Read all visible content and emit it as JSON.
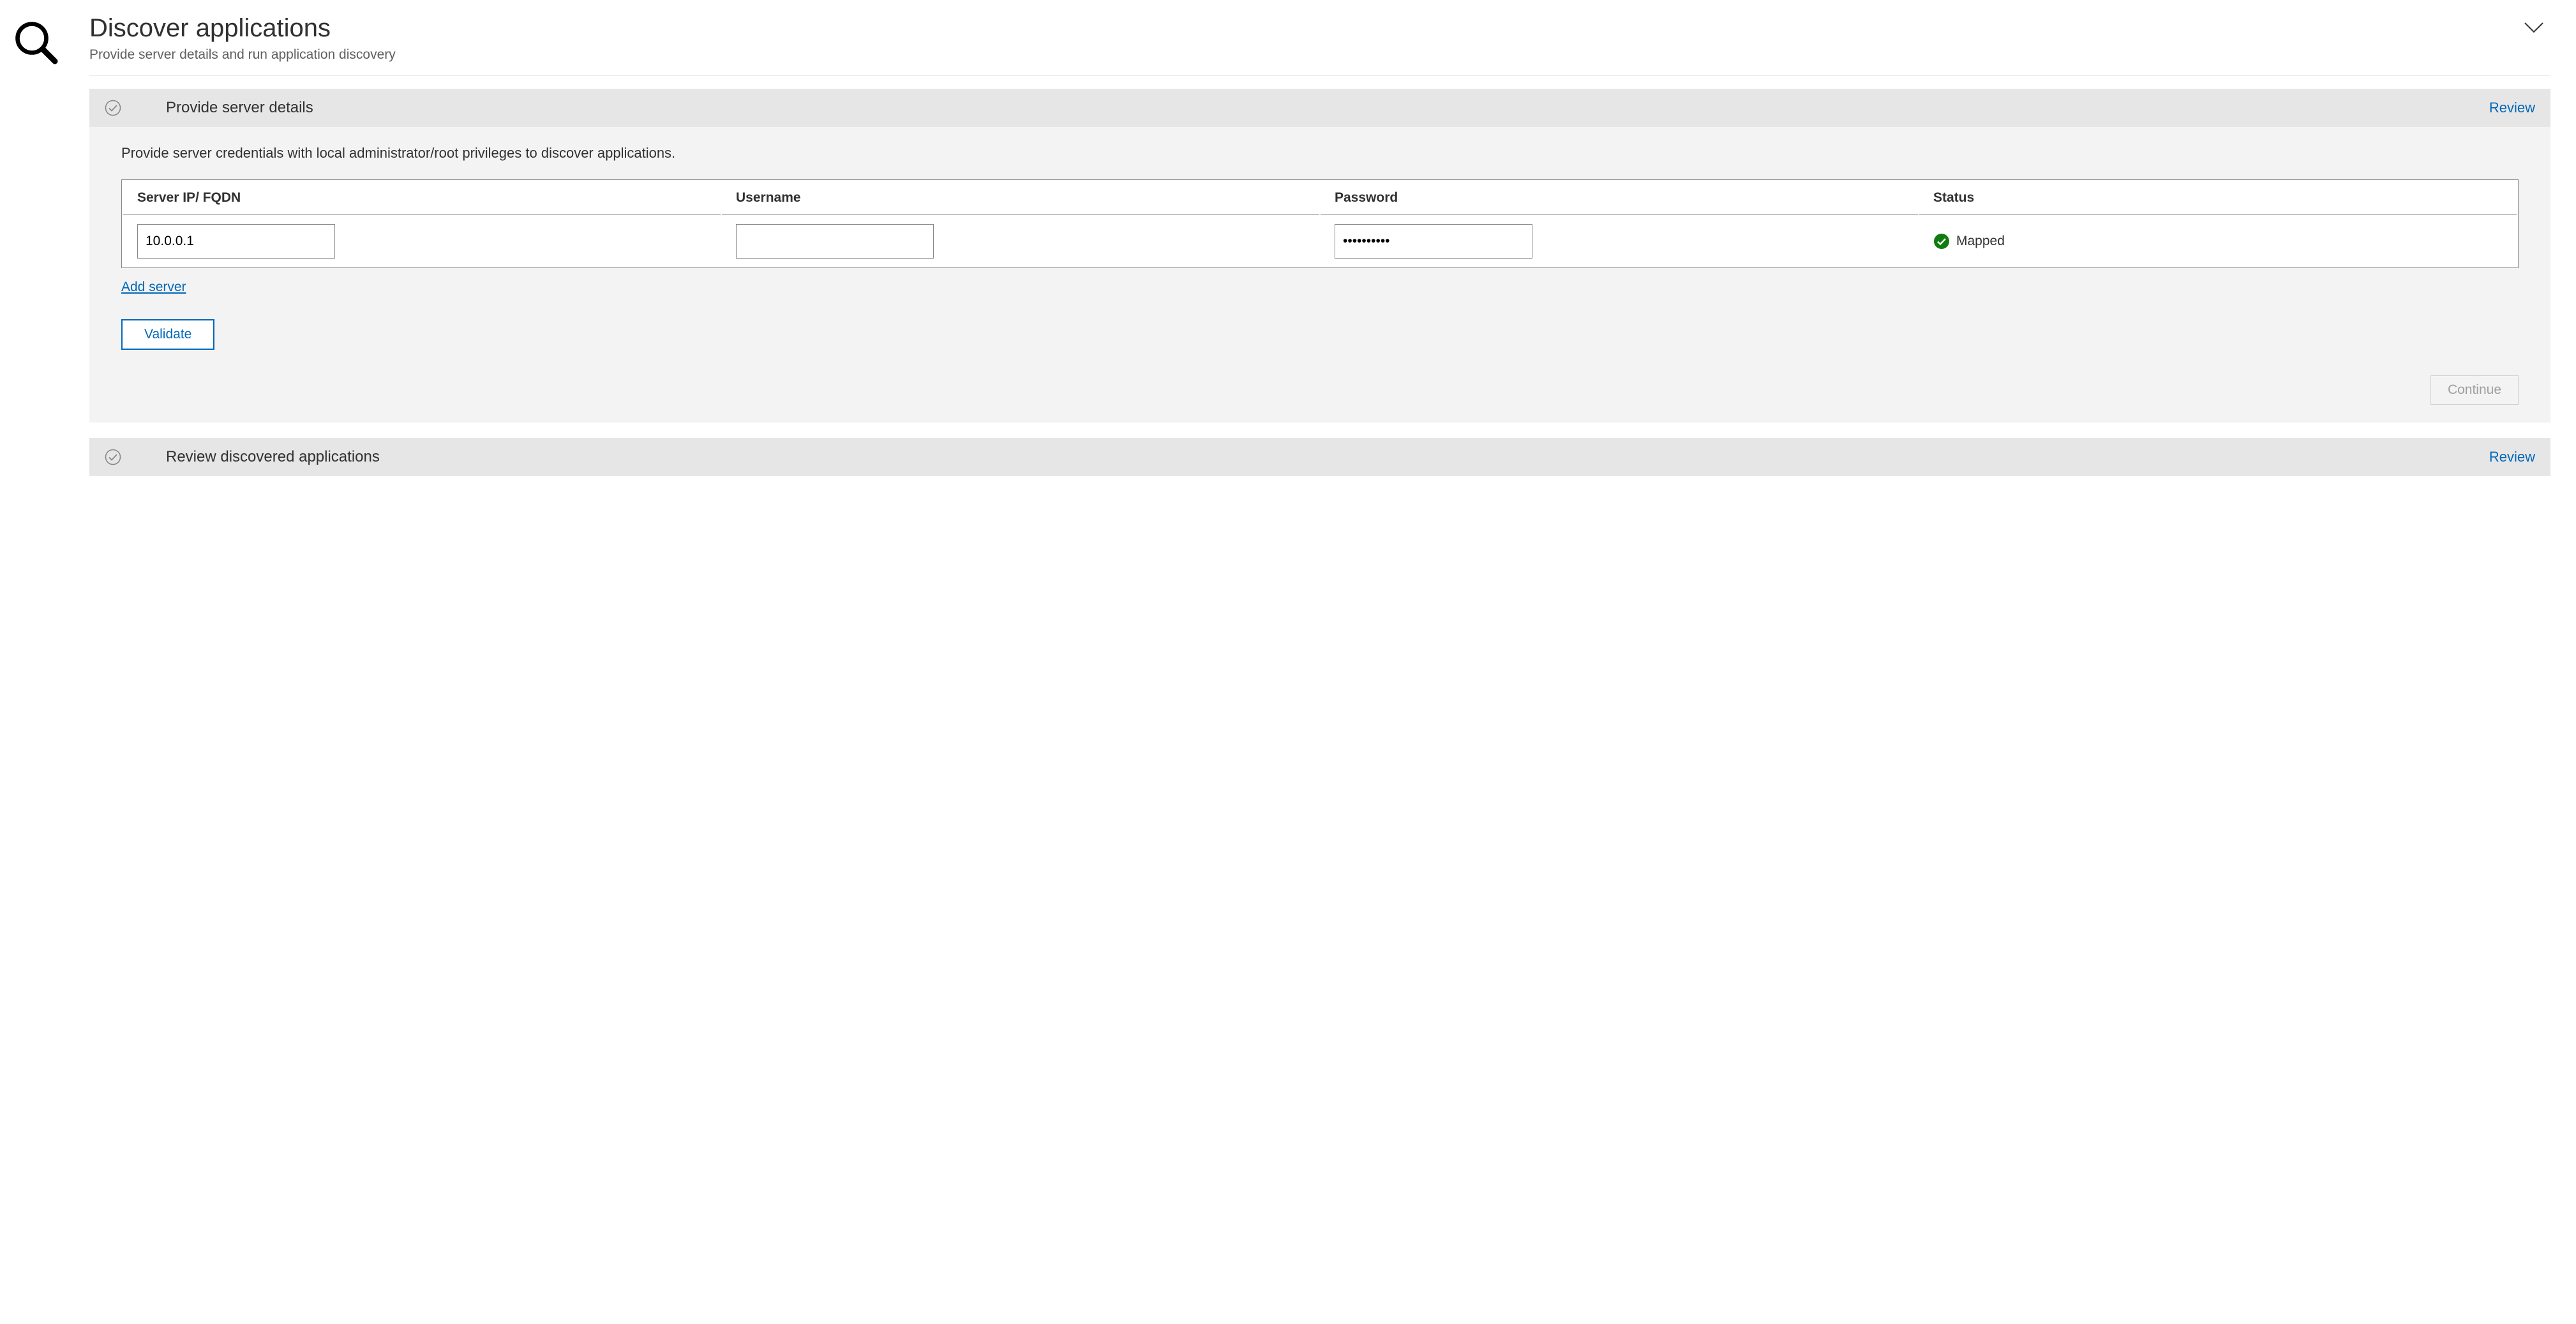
{
  "header": {
    "title": "Discover applications",
    "subtitle": "Provide server details and run application discovery"
  },
  "section1": {
    "title": "Provide server details",
    "review_label": "Review",
    "description": "Provide server credentials with local administrator/root privileges to discover applications.",
    "columns": {
      "server": "Server IP/ FQDN",
      "username": "Username",
      "password": "Password",
      "status": "Status"
    },
    "row": {
      "server_value": "10.0.0.1",
      "username_value": "",
      "password_value": "••••••••••",
      "status_label": "Mapped"
    },
    "add_server_label": "Add server",
    "validate_label": "Validate",
    "continue_label": "Continue"
  },
  "section2": {
    "title": "Review discovered applications",
    "review_label": "Review"
  }
}
